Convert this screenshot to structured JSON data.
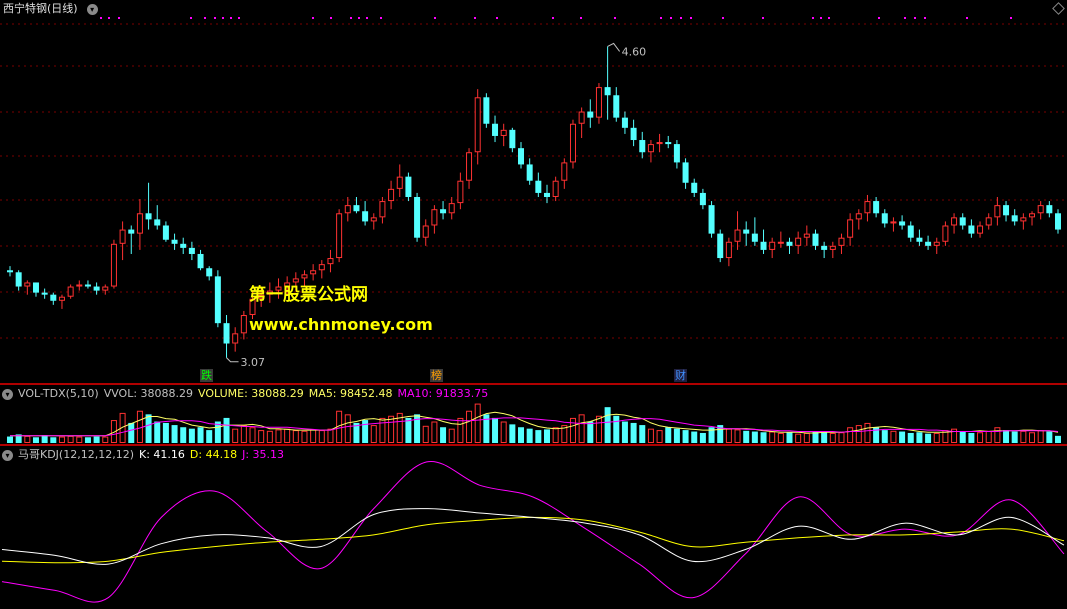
{
  "title": "西宁特钢(日线)",
  "watermark": {
    "line1": "第一股票公式网",
    "line2": "www.chnmoney.com"
  },
  "price": {
    "high_label": "4.60",
    "low_label": "3.07"
  },
  "event_tags": [
    "跌",
    "榜",
    "财"
  ],
  "volume_indicator": {
    "name": "VOL-TDX(5,10)",
    "vvol": "VVOL: 38088.29",
    "volume": "VOLUME: 38088.29",
    "ma5": "MA5: 98452.48",
    "ma10": "MA10: 91833.75"
  },
  "kdj_indicator": {
    "name": "马哥KDJ(12,12,12,12)",
    "k": "K: 41.16",
    "d": "D: 44.18",
    "j": "J: 35.13"
  },
  "colors": {
    "up": "#ff3232",
    "down": "#54ffff",
    "ma5": "#ffff66",
    "ma10": "#ff00ff",
    "k": "#ffffff",
    "d": "#ffff00",
    "j": "#ff00ff",
    "separator": "#b00000"
  },
  "chart_data": {
    "type": "candlestick",
    "y_range": [
      3.0,
      4.72
    ],
    "ohlc": [
      [
        3.5,
        3.52,
        3.47,
        3.49
      ],
      [
        3.49,
        3.5,
        3.4,
        3.42
      ],
      [
        3.42,
        3.45,
        3.38,
        3.44
      ],
      [
        3.44,
        3.44,
        3.37,
        3.39
      ],
      [
        3.39,
        3.41,
        3.36,
        3.38
      ],
      [
        3.38,
        3.39,
        3.33,
        3.35
      ],
      [
        3.35,
        3.38,
        3.31,
        3.37
      ],
      [
        3.37,
        3.43,
        3.36,
        3.42
      ],
      [
        3.42,
        3.45,
        3.4,
        3.43
      ],
      [
        3.43,
        3.45,
        3.41,
        3.42
      ],
      [
        3.42,
        3.44,
        3.38,
        3.4
      ],
      [
        3.4,
        3.43,
        3.38,
        3.42
      ],
      [
        3.42,
        3.65,
        3.41,
        3.63
      ],
      [
        3.63,
        3.74,
        3.55,
        3.7
      ],
      [
        3.7,
        3.72,
        3.58,
        3.68
      ],
      [
        3.68,
        3.85,
        3.6,
        3.78
      ],
      [
        3.78,
        3.93,
        3.7,
        3.75
      ],
      [
        3.75,
        3.82,
        3.7,
        3.72
      ],
      [
        3.72,
        3.74,
        3.64,
        3.65
      ],
      [
        3.65,
        3.68,
        3.6,
        3.63
      ],
      [
        3.63,
        3.66,
        3.58,
        3.61
      ],
      [
        3.61,
        3.64,
        3.55,
        3.58
      ],
      [
        3.58,
        3.6,
        3.5,
        3.51
      ],
      [
        3.51,
        3.52,
        3.45,
        3.47
      ],
      [
        3.47,
        3.5,
        3.22,
        3.24
      ],
      [
        3.24,
        3.28,
        3.07,
        3.14
      ],
      [
        3.14,
        3.22,
        3.1,
        3.19
      ],
      [
        3.19,
        3.3,
        3.16,
        3.28
      ],
      [
        3.28,
        3.4,
        3.26,
        3.36
      ],
      [
        3.36,
        3.42,
        3.32,
        3.38
      ],
      [
        3.38,
        3.44,
        3.34,
        3.4
      ],
      [
        3.4,
        3.46,
        3.36,
        3.42
      ],
      [
        3.42,
        3.47,
        3.38,
        3.44
      ],
      [
        3.44,
        3.49,
        3.4,
        3.46
      ],
      [
        3.46,
        3.5,
        3.42,
        3.48
      ],
      [
        3.48,
        3.53,
        3.45,
        3.5
      ],
      [
        3.5,
        3.55,
        3.46,
        3.53
      ],
      [
        3.53,
        3.6,
        3.49,
        3.56
      ],
      [
        3.56,
        3.8,
        3.54,
        3.78
      ],
      [
        3.78,
        3.86,
        3.74,
        3.82
      ],
      [
        3.82,
        3.86,
        3.78,
        3.79
      ],
      [
        3.79,
        3.84,
        3.72,
        3.74
      ],
      [
        3.74,
        3.78,
        3.7,
        3.76
      ],
      [
        3.76,
        3.86,
        3.73,
        3.84
      ],
      [
        3.84,
        3.94,
        3.8,
        3.9
      ],
      [
        3.9,
        4.02,
        3.86,
        3.96
      ],
      [
        3.96,
        3.98,
        3.84,
        3.86
      ],
      [
        3.86,
        3.88,
        3.64,
        3.66
      ],
      [
        3.66,
        3.75,
        3.62,
        3.72
      ],
      [
        3.72,
        3.82,
        3.68,
        3.8
      ],
      [
        3.8,
        3.84,
        3.75,
        3.78
      ],
      [
        3.78,
        3.86,
        3.75,
        3.83
      ],
      [
        3.83,
        3.98,
        3.8,
        3.94
      ],
      [
        3.94,
        4.1,
        3.9,
        4.08
      ],
      [
        4.08,
        4.39,
        4.02,
        4.35
      ],
      [
        4.35,
        4.37,
        4.2,
        4.22
      ],
      [
        4.22,
        4.26,
        4.13,
        4.16
      ],
      [
        4.16,
        4.22,
        4.11,
        4.19
      ],
      [
        4.19,
        4.2,
        4.08,
        4.1
      ],
      [
        4.1,
        4.13,
        4.0,
        4.02
      ],
      [
        4.02,
        4.05,
        3.92,
        3.94
      ],
      [
        3.94,
        3.98,
        3.86,
        3.88
      ],
      [
        3.88,
        3.92,
        3.83,
        3.86
      ],
      [
        3.86,
        3.96,
        3.84,
        3.94
      ],
      [
        3.94,
        4.05,
        3.9,
        4.03
      ],
      [
        4.03,
        4.24,
        4.0,
        4.22
      ],
      [
        4.22,
        4.3,
        4.15,
        4.28
      ],
      [
        4.28,
        4.34,
        4.2,
        4.25
      ],
      [
        4.25,
        4.42,
        4.22,
        4.4
      ],
      [
        4.4,
        4.6,
        4.24,
        4.36
      ],
      [
        4.36,
        4.4,
        4.23,
        4.25
      ],
      [
        4.25,
        4.28,
        4.17,
        4.2
      ],
      [
        4.2,
        4.24,
        4.11,
        4.14
      ],
      [
        4.14,
        4.18,
        4.05,
        4.08
      ],
      [
        4.08,
        4.14,
        4.03,
        4.12
      ],
      [
        4.12,
        4.17,
        4.08,
        4.13
      ],
      [
        4.13,
        4.16,
        4.1,
        4.12
      ],
      [
        4.12,
        4.14,
        4.0,
        4.03
      ],
      [
        4.03,
        4.05,
        3.9,
        3.93
      ],
      [
        3.93,
        3.95,
        3.86,
        3.88
      ],
      [
        3.88,
        3.9,
        3.8,
        3.82
      ],
      [
        3.82,
        3.84,
        3.66,
        3.68
      ],
      [
        3.68,
        3.7,
        3.54,
        3.56
      ],
      [
        3.56,
        3.66,
        3.52,
        3.64
      ],
      [
        3.64,
        3.79,
        3.6,
        3.7
      ],
      [
        3.7,
        3.74,
        3.62,
        3.68
      ],
      [
        3.68,
        3.76,
        3.62,
        3.64
      ],
      [
        3.64,
        3.7,
        3.58,
        3.6
      ],
      [
        3.6,
        3.66,
        3.56,
        3.64
      ],
      [
        3.64,
        3.69,
        3.61,
        3.64
      ],
      [
        3.64,
        3.66,
        3.58,
        3.62
      ],
      [
        3.62,
        3.69,
        3.58,
        3.66
      ],
      [
        3.66,
        3.72,
        3.62,
        3.68
      ],
      [
        3.68,
        3.7,
        3.6,
        3.62
      ],
      [
        3.62,
        3.64,
        3.56,
        3.6
      ],
      [
        3.6,
        3.64,
        3.56,
        3.62
      ],
      [
        3.62,
        3.68,
        3.58,
        3.66
      ],
      [
        3.66,
        3.78,
        3.62,
        3.75
      ],
      [
        3.75,
        3.8,
        3.7,
        3.78
      ],
      [
        3.78,
        3.87,
        3.74,
        3.84
      ],
      [
        3.84,
        3.86,
        3.76,
        3.78
      ],
      [
        3.78,
        3.8,
        3.71,
        3.73
      ],
      [
        3.73,
        3.76,
        3.69,
        3.74
      ],
      [
        3.74,
        3.77,
        3.7,
        3.72
      ],
      [
        3.72,
        3.74,
        3.64,
        3.66
      ],
      [
        3.66,
        3.7,
        3.62,
        3.64
      ],
      [
        3.64,
        3.67,
        3.6,
        3.62
      ],
      [
        3.62,
        3.66,
        3.58,
        3.64
      ],
      [
        3.64,
        3.74,
        3.62,
        3.72
      ],
      [
        3.72,
        3.78,
        3.68,
        3.76
      ],
      [
        3.76,
        3.78,
        3.7,
        3.72
      ],
      [
        3.72,
        3.75,
        3.66,
        3.68
      ],
      [
        3.68,
        3.74,
        3.66,
        3.72
      ],
      [
        3.72,
        3.78,
        3.7,
        3.76
      ],
      [
        3.76,
        3.86,
        3.72,
        3.82
      ],
      [
        3.82,
        3.84,
        3.74,
        3.77
      ],
      [
        3.77,
        3.8,
        3.72,
        3.74
      ],
      [
        3.74,
        3.78,
        3.7,
        3.76
      ],
      [
        3.76,
        3.79,
        3.72,
        3.78
      ],
      [
        3.78,
        3.84,
        3.75,
        3.82
      ],
      [
        3.82,
        3.84,
        3.76,
        3.78
      ],
      [
        3.78,
        3.8,
        3.68,
        3.7
      ]
    ],
    "volume": [
      9,
      12,
      10,
      8,
      11,
      8,
      9,
      10,
      9,
      8,
      9,
      9,
      32,
      42,
      28,
      45,
      40,
      30,
      28,
      25,
      22,
      20,
      22,
      18,
      30,
      35,
      20,
      25,
      22,
      18,
      17,
      19,
      20,
      18,
      17,
      19,
      18,
      20,
      45,
      40,
      28,
      32,
      25,
      35,
      38,
      42,
      35,
      40,
      24,
      30,
      22,
      20,
      35,
      45,
      55,
      40,
      35,
      30,
      26,
      22,
      20,
      18,
      19,
      22,
      25,
      35,
      40,
      30,
      38,
      50,
      38,
      30,
      28,
      25,
      20,
      18,
      22,
      20,
      18,
      16,
      14,
      22,
      25,
      20,
      19,
      17,
      16,
      15,
      16,
      14,
      15,
      13,
      14,
      16,
      15,
      14,
      15,
      22,
      25,
      28,
      22,
      18,
      17,
      16,
      14,
      15,
      13,
      14,
      18,
      20,
      16,
      14,
      15,
      17,
      22,
      18,
      16,
      17,
      15,
      18,
      16,
      10
    ],
    "vol_max": 60,
    "ma5": [
      10,
      10,
      10,
      10,
      10,
      10,
      10,
      10,
      10,
      10,
      10,
      10,
      15,
      22,
      27,
      32,
      37,
      37,
      34,
      33,
      29,
      25,
      23,
      21,
      22,
      25,
      25,
      25,
      26,
      24,
      20,
      20,
      19,
      18,
      18,
      18,
      18,
      18,
      24,
      28,
      30,
      33,
      34,
      32,
      33,
      35,
      37,
      38,
      36,
      34,
      30,
      27,
      26,
      30,
      36,
      41,
      43,
      41,
      38,
      32,
      27,
      23,
      21,
      20,
      21,
      24,
      28,
      30,
      34,
      39,
      40,
      39,
      36,
      34,
      28,
      24,
      22,
      21,
      20,
      19,
      18,
      18,
      19,
      20,
      20,
      20,
      19,
      17,
      16,
      15,
      15,
      15,
      14,
      14,
      15,
      15,
      15,
      16,
      18,
      21,
      22,
      23,
      22,
      20,
      18,
      16,
      15,
      15,
      15,
      16,
      16,
      16,
      17,
      16,
      17,
      17,
      17,
      18,
      18,
      17,
      17,
      15
    ],
    "ma10": [
      10,
      10,
      10,
      10,
      10,
      10,
      10,
      10,
      10,
      10,
      10,
      10,
      12,
      15,
      18,
      21,
      25,
      29,
      30,
      31,
      31,
      31,
      30,
      27,
      26,
      25,
      24,
      23,
      23,
      22,
      22,
      22,
      22,
      21,
      20,
      19,
      18,
      18,
      21,
      23,
      24,
      26,
      27,
      28,
      29,
      30,
      31,
      33,
      34,
      34,
      33,
      32,
      31,
      31,
      32,
      33,
      34,
      35,
      35,
      35,
      34,
      33,
      32,
      31,
      29,
      28,
      27,
      27,
      28,
      29,
      30,
      32,
      33,
      34,
      34,
      33,
      31,
      29,
      27,
      25,
      24,
      23,
      21,
      20,
      20,
      19,
      19,
      18,
      18,
      17,
      17,
      16,
      16,
      16,
      16,
      16,
      15,
      16,
      16,
      17,
      18,
      19,
      19,
      19,
      19,
      19,
      18,
      18,
      17,
      16,
      16,
      16,
      16,
      16,
      16,
      17,
      17,
      17,
      17,
      17,
      17,
      16
    ],
    "kdj_x": [
      0,
      0.05,
      0.1,
      0.15,
      0.2,
      0.25,
      0.3,
      0.35,
      0.4,
      0.45,
      0.5,
      0.55,
      0.6,
      0.65,
      0.7,
      0.75,
      0.8,
      0.85,
      0.9,
      0.95,
      1
    ],
    "kdj_k": [
      38,
      34,
      28,
      42,
      48,
      46,
      40,
      62,
      66,
      63,
      60,
      56,
      48,
      30,
      38,
      54,
      45,
      56,
      48,
      60,
      41
    ],
    "kdj_d": [
      30,
      29,
      30,
      36,
      40,
      43,
      45,
      48,
      55,
      58,
      60,
      58,
      50,
      40,
      43,
      46,
      48,
      48,
      50,
      52,
      44
    ],
    "kdj_j": [
      16,
      10,
      5,
      60,
      78,
      50,
      25,
      66,
      98,
      82,
      74,
      52,
      28,
      5,
      35,
      74,
      48,
      52,
      48,
      72,
      35
    ]
  }
}
